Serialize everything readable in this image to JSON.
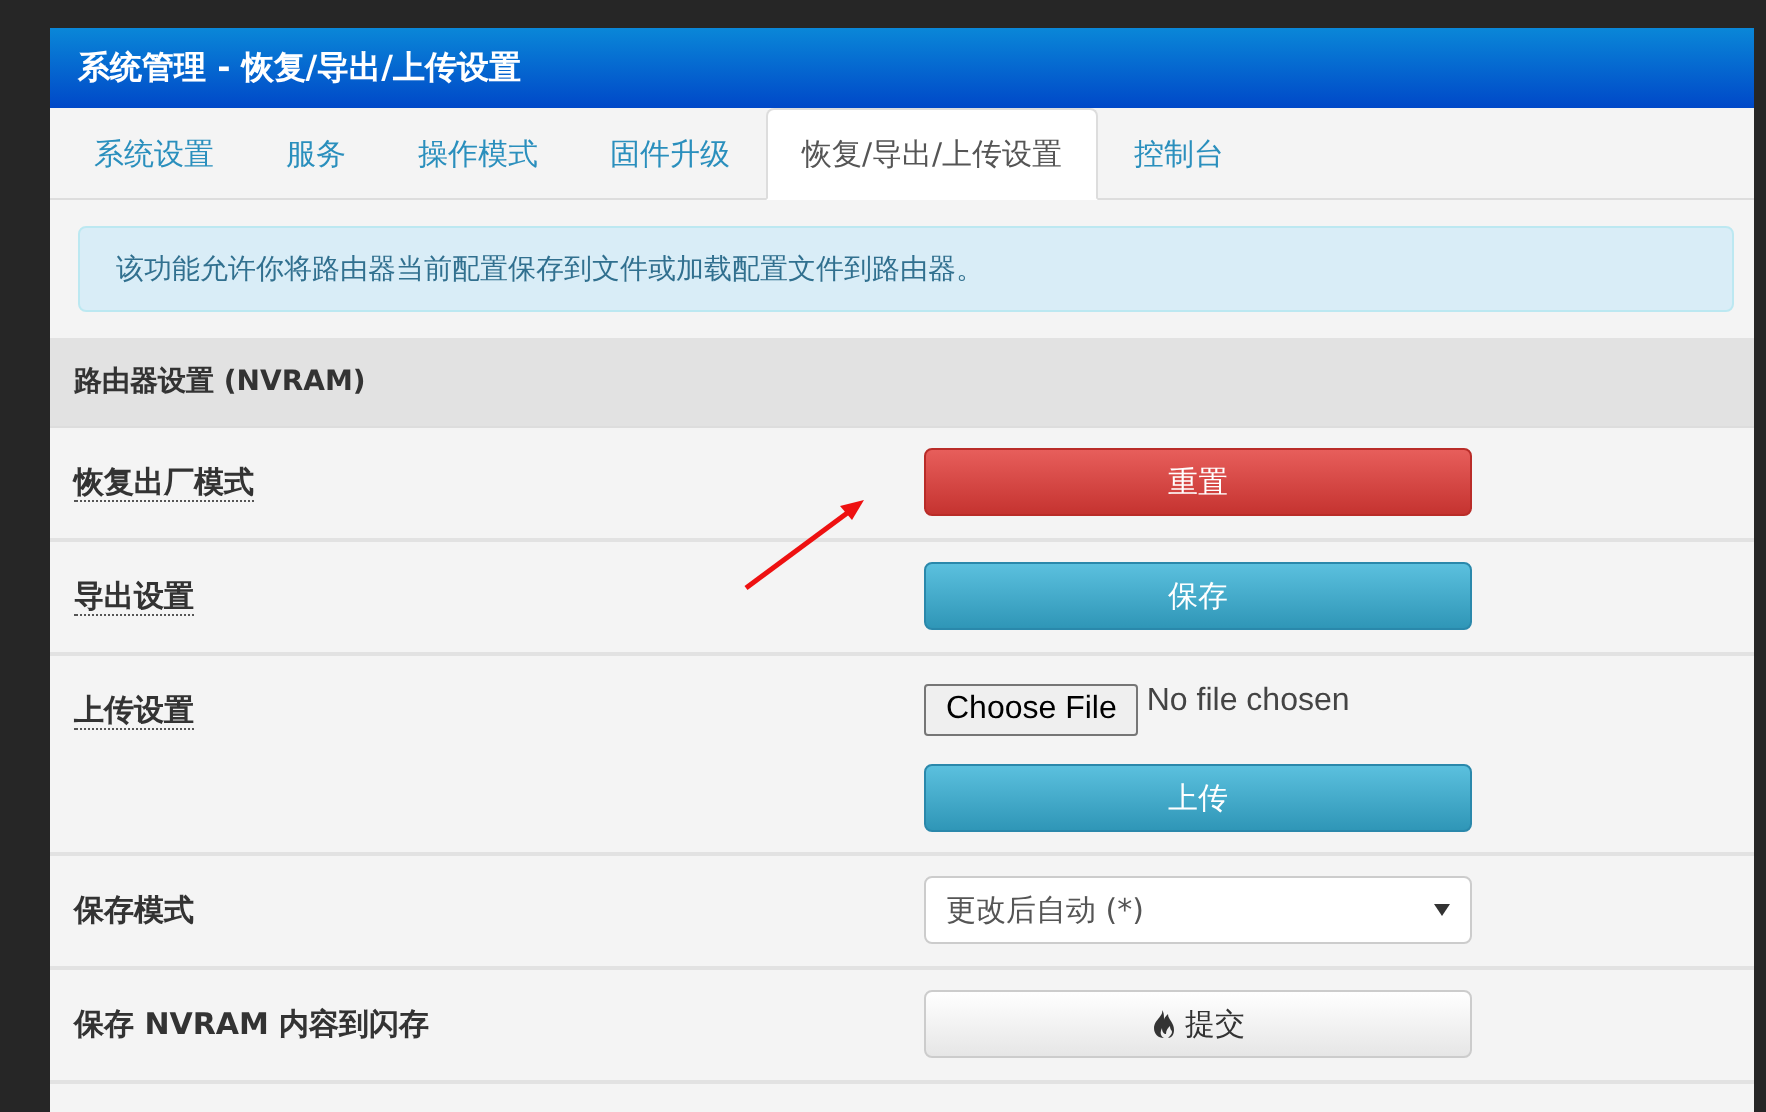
{
  "header": {
    "title": "系统管理 - 恢复/导出/上传设置"
  },
  "tabs": [
    {
      "label": "系统设置",
      "selected": false
    },
    {
      "label": "服务",
      "selected": false
    },
    {
      "label": "操作模式",
      "selected": false
    },
    {
      "label": "固件升级",
      "selected": false
    },
    {
      "label": "恢复/导出/上传设置",
      "selected": true
    },
    {
      "label": "控制台",
      "selected": false
    }
  ],
  "info": "该功能允许你将路由器当前配置保存到文件或加载配置文件到路由器。",
  "section": {
    "title": "路由器设置 (NVRAM)",
    "rows": [
      {
        "kind": "button",
        "label": "恢复出厂模式",
        "tooltip": true,
        "button": {
          "label": "重置",
          "kind": "danger"
        }
      },
      {
        "kind": "button",
        "label": "导出设置",
        "tooltip": true,
        "button": {
          "label": "保存",
          "kind": "info"
        }
      },
      {
        "kind": "upload",
        "label": "上传设置",
        "tooltip": true,
        "file_button": "Choose File",
        "file_status": "No file chosen",
        "button": {
          "label": "上传",
          "kind": "info"
        }
      },
      {
        "kind": "select",
        "label": "保存模式",
        "tooltip": false,
        "value": "更改后自动 (*)"
      },
      {
        "kind": "button",
        "label": "保存 NVRAM 内容到闪存",
        "tooltip": false,
        "button": {
          "label": "提交",
          "kind": "submit"
        }
      }
    ]
  }
}
